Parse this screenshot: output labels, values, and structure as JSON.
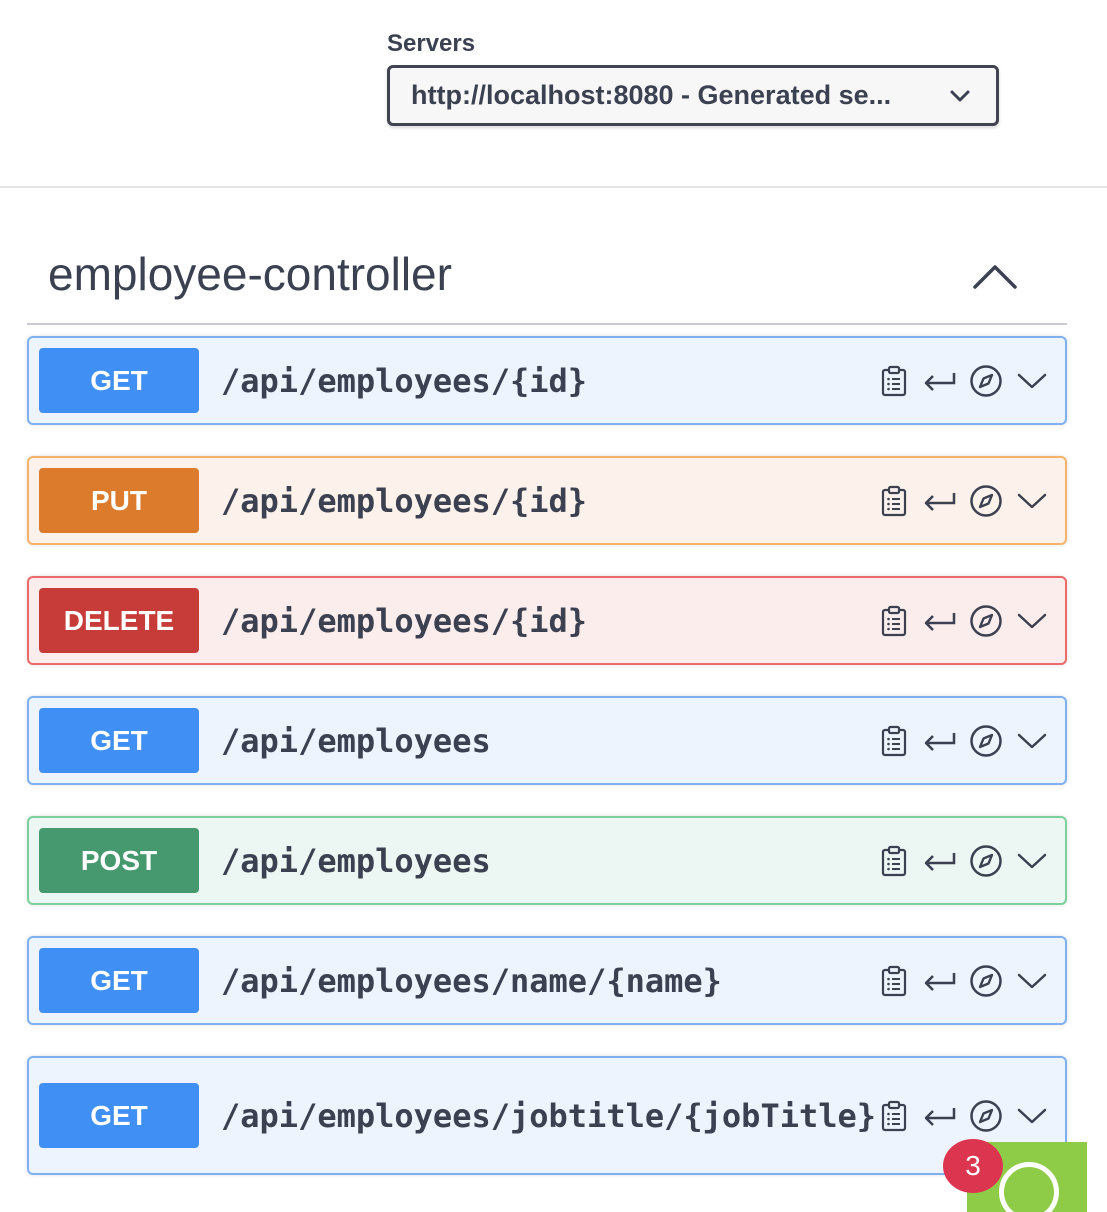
{
  "servers": {
    "label": "Servers",
    "selected": "http://localhost:8080 - Generated se..."
  },
  "tag": {
    "name": "employee-controller"
  },
  "operations": [
    {
      "method": "GET",
      "path": "/api/employees/{id}"
    },
    {
      "method": "PUT",
      "path": "/api/employees/{id}"
    },
    {
      "method": "DELETE",
      "path": "/api/employees/{id}"
    },
    {
      "method": "GET",
      "path": "/api/employees"
    },
    {
      "method": "POST",
      "path": "/api/employees"
    },
    {
      "method": "GET",
      "path": "/api/employees/name/{name}"
    },
    {
      "method": "GET",
      "path": "/api/employees/jobtitle/{jobTitle}"
    }
  ],
  "icons": {
    "server_select": "chevron-down-icon",
    "tag_toggle": "chevron-up-icon",
    "op_actions": [
      "clipboard-icon",
      "return-icon",
      "compass-icon",
      "chevron-down-icon"
    ]
  },
  "widget": {
    "badge_count": "3"
  },
  "colors": {
    "get": "#3f8ff5",
    "put": "#dd7b2c",
    "delete": "#c73c38",
    "post": "#46996f",
    "widget": "#8ecc47",
    "badge": "#dc3550"
  }
}
